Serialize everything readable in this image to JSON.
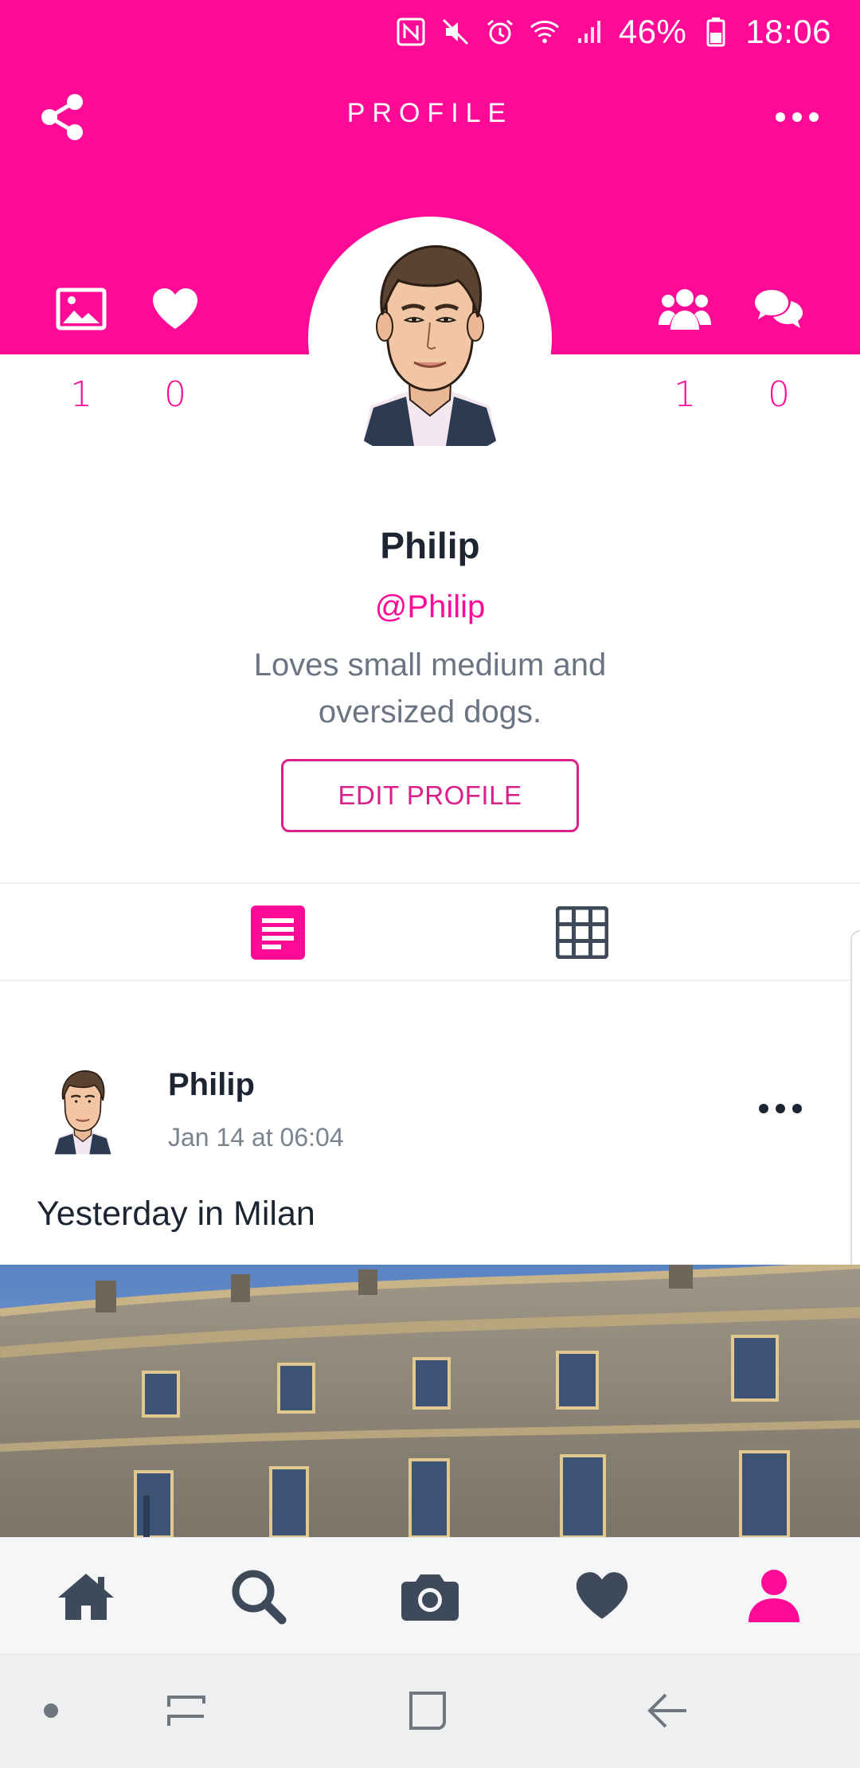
{
  "status_bar": {
    "battery": "46%",
    "time": "18:06",
    "icons": [
      "nfc-icon",
      "mute-icon",
      "alarm-icon",
      "wifi-icon",
      "signal-icon",
      "battery-icon"
    ]
  },
  "app_bar": {
    "title": "PROFILE"
  },
  "stats": {
    "photos": "1",
    "likes": "0",
    "followers": "1",
    "comments": "0"
  },
  "profile": {
    "name": "Philip",
    "handle": "@Philip",
    "bio": "Loves small medium and oversized dogs.",
    "edit_label": "EDIT PROFILE"
  },
  "post": {
    "author": "Philip",
    "time": "Jan 14 at 06:04",
    "caption": "Yesterday in Milan"
  },
  "colors": {
    "accent": "#ff0a96",
    "dark": "#1d2533",
    "icon_gray": "#3e4a59"
  }
}
